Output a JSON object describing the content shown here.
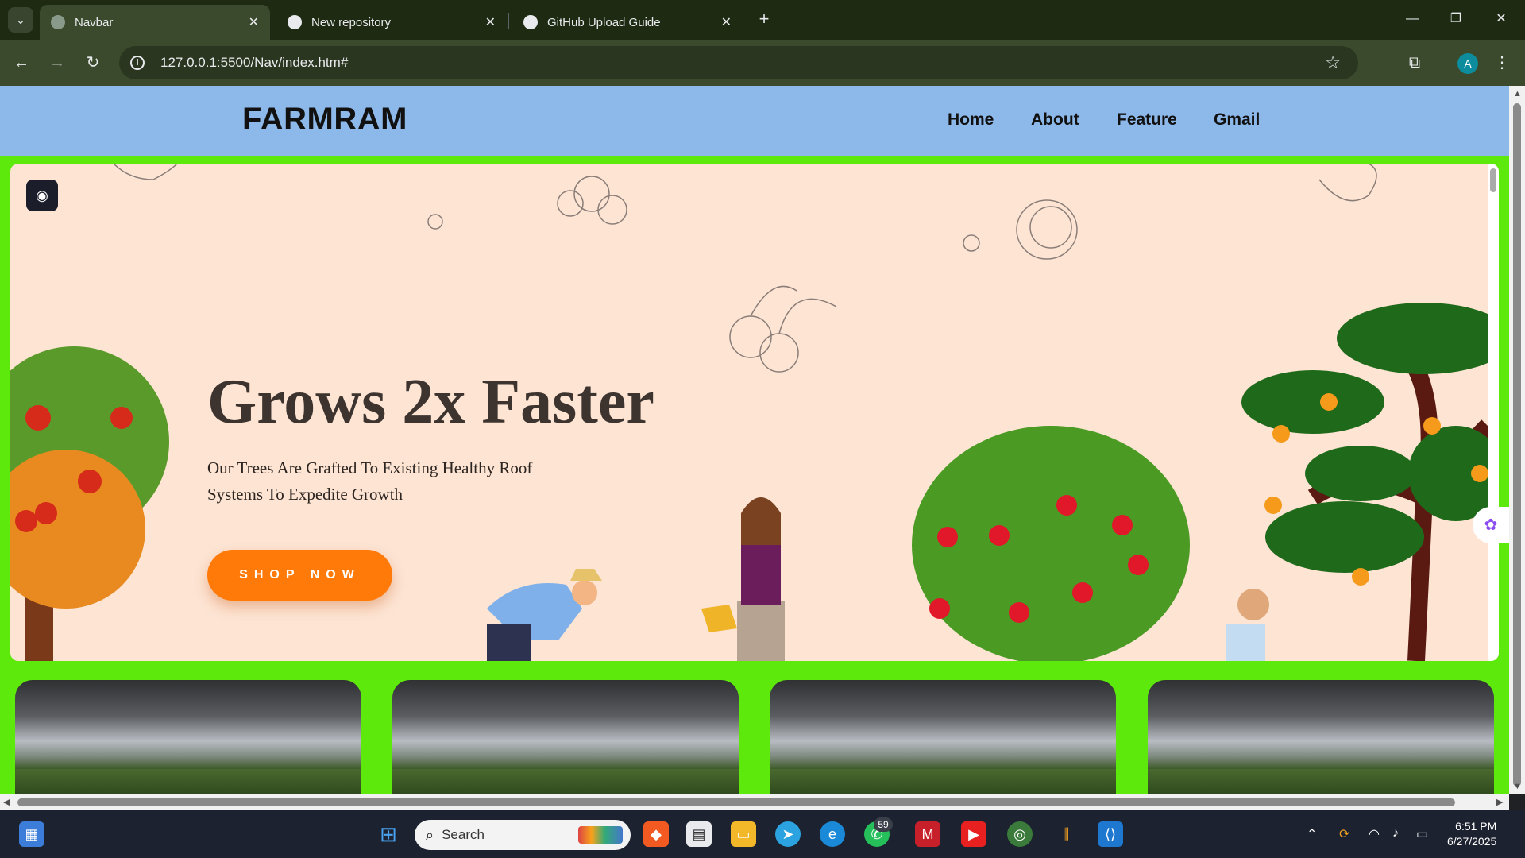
{
  "browser": {
    "tabs": [
      {
        "title": "Navbar",
        "active": true,
        "favicon": "globe-icon"
      },
      {
        "title": "New repository",
        "active": false,
        "favicon": "github-icon"
      },
      {
        "title": "GitHub Upload Guide",
        "active": false,
        "favicon": "openai-icon"
      }
    ],
    "url": "127.0.0.1:5500/Nav/index.htm#",
    "profile_initial": "A"
  },
  "site": {
    "brand": "FARMRAM",
    "nav": [
      "Home",
      "About",
      "Feature",
      "Gmail"
    ],
    "hero": {
      "title": "Grows 2x Faster",
      "subtitle": "Our Trees Are Grafted To Existing Healthy Roof Systems To Expedite Growth",
      "cta": "SHOP NOW"
    },
    "colors": {
      "navbar": "#8db8ea",
      "page_bg": "#5ee90c",
      "hero_bg": "#fde4d3",
      "cta": "#ff7a08"
    }
  },
  "taskbar": {
    "search_label": "Search",
    "whatsapp_badge": "59",
    "time": "6:51 PM",
    "date": "6/27/2025"
  }
}
